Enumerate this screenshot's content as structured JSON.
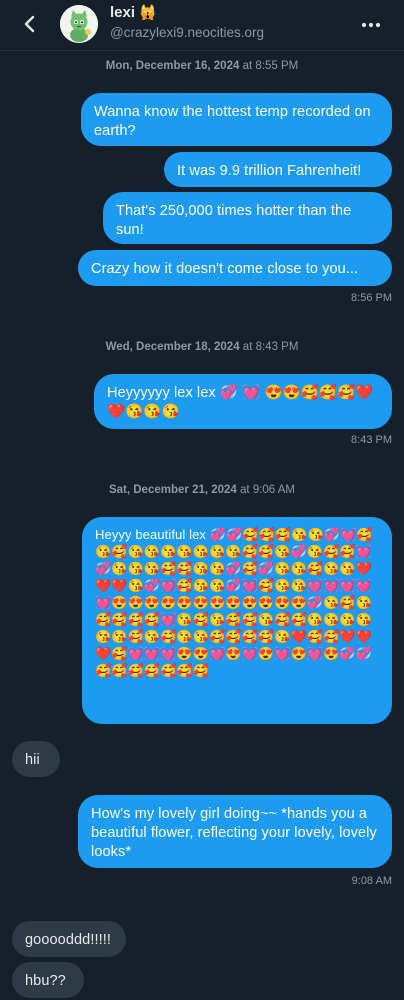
{
  "header": {
    "name": "lexi",
    "name_emoji": "🙀",
    "handle": "@crazylexi9.neocities.org"
  },
  "icons": {
    "back": "chevron-left-icon",
    "more": "more-dots-icon",
    "avatar": "cat-avatar"
  },
  "colors": {
    "background": "#15202b",
    "outgoing": "#1d9bf0",
    "incoming": "#2f3a47"
  },
  "sections": [
    {
      "date": "Mon, December 16, 2024",
      "at": "at 8:55 PM",
      "time": "8:56 PM",
      "messages": [
        "Wanna know the hottest temp recorded on earth?",
        "It was 9.9 trillion Fahrenheit!",
        "That's 250,000 times hotter than the sun!",
        "Crazy how it doesn't come close to you..."
      ]
    },
    {
      "date": "Wed, December 18, 2024",
      "at": "at 8:43 PM",
      "time": "8:43 PM",
      "messages": [
        "Heyyyyyy lex lex 💞 💓 😍😍🥰🥰🥰❤️❤️😘😘😘"
      ]
    },
    {
      "date": "Sat, December 21, 2024",
      "at": "at 9:06 AM",
      "time": "9:08 AM",
      "messages": [
        "Heyyy beautiful lex 💞💞🥰🥰🥰😘😘💞💓🥰😘🥰😘😘😘😘😘😘😘🥰🥰😘💞😘🥰🥰💓💞😘😘😘🥰🥰😘😘💞🥰💞😘😘🥰😘😘❤️❤️❤️😘💞💓🥰😘😘💞💓🥰😘😘💓💓💓💓💓😍😍😍😍😍😍😍😍😍😍😍😍💞😘🥰😘🥰🥰🥰🥰💓😘🥰😘🥰🥰😘🥰🥰😘😘😘😘😘😘🥰😘🥰😘😘🥰🥰🥰🥰😘❤️🥰🥰❤️❤️❤️🥰💓💓💓😍😍💓😍💓😍💓😍💓😍💞💞🥰🥰🥰🥰🥰🥰🥰",
        "How's my lovely girl doing~~ *hands you a beautiful flower, reflecting your lovely, lovely looks*"
      ],
      "incoming_before": "hii"
    }
  ],
  "incoming_end": [
    "gooooddd!!!!!",
    "hbu??"
  ]
}
